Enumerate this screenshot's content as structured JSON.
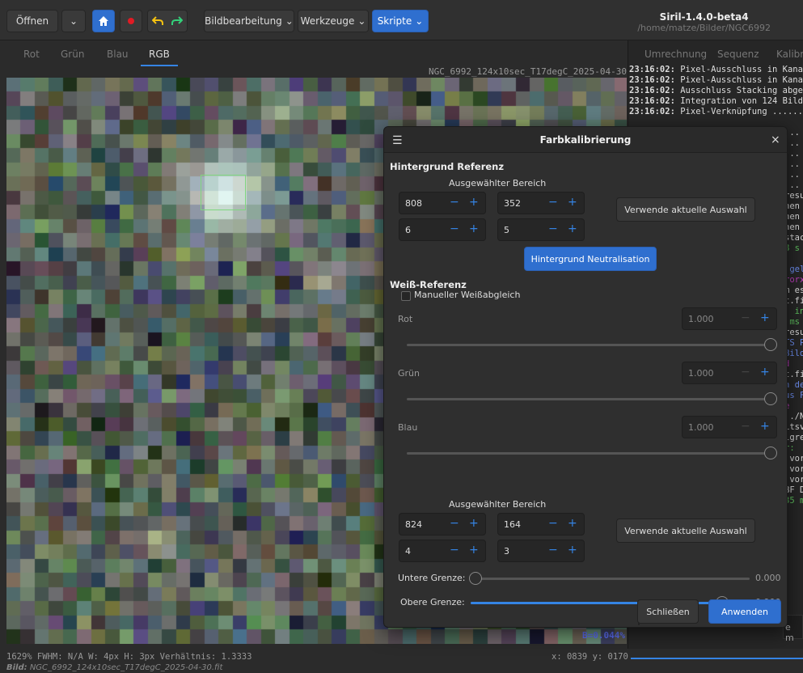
{
  "header": {
    "open_label": "Öffnen",
    "image_processing_label": "Bildbearbeitung",
    "tools_label": "Werkzeuge",
    "scripts_label": "Skripte",
    "app_title": "Siril-1.4.0-beta4",
    "app_path": "/home/matze/Bilder/NGC6992"
  },
  "channel_tabs": [
    "Rot",
    "Grün",
    "Blau",
    "RGB"
  ],
  "active_channel": "RGB",
  "right_tabs": [
    "Umrechnung",
    "Sequenz",
    "Kalibr"
  ],
  "image": {
    "filename": "NGC_6992_124x10sec_T17degC_2025-04-30.fit",
    "b_value": "B=0.044%"
  },
  "console": [
    {
      "time": "23:16:02:",
      "text": " Pixel-Ausschluss in Kanal"
    },
    {
      "time": "23:16:02:",
      "text": " Pixel-Ausschluss in Kanal"
    },
    {
      "time": "23:16:02:",
      "text": " Ausschluss Stacking abgesc"
    },
    {
      "time": "23:16:02:",
      "text": " Integration von 124 Bilder"
    },
    {
      "time": "23:16:02:",
      "text": " Pixel-Verknüpfung ........"
    }
  ],
  "console_tail": [
    {
      "text": "",
      "color": "#ddd"
    },
    {
      "text": "...",
      "color": "#ddd"
    },
    {
      "text": "...",
      "color": "#ddd"
    },
    {
      "text": "...",
      "color": "#ddd"
    },
    {
      "text": "... n",
      "color": "#ddd"
    },
    {
      "text": "...",
      "color": "#ddd"
    },
    {
      "text": "...",
      "color": "#ddd"
    },
    {
      "text": "resu",
      "color": "#ddd"
    },
    {
      "text": "hen",
      "color": "#ddd"
    },
    {
      "text": "hen",
      "color": "#ddd"
    },
    {
      "text": "hen",
      "color": "#ddd"
    },
    {
      "text": "stac",
      "color": "#ddd"
    },
    {
      "text": "8 s",
      "color": "#5ec05e"
    },
    {
      "text": "",
      "color": "#ddd"
    },
    {
      "text": " gel",
      "color": "#6d8ef0"
    },
    {
      "text": "rorx",
      "color": "#c03fc0"
    },
    {
      "text": "m es",
      "color": "#ddd"
    },
    {
      "text": "t.fi",
      "color": "#ddd"
    },
    {
      "text": ": in",
      "color": "#5ec05e"
    },
    {
      "text": " ms",
      "color": "#5ec05e"
    },
    {
      "text": "resu",
      "color": "#ddd"
    },
    {
      "text": "TS P",
      "color": "#6d8ef0"
    },
    {
      "text": "Bild",
      "color": "#6d8ef0"
    },
    {
      "text": "d",
      "color": "#c03fc0"
    },
    {
      "text": "t.fi",
      "color": "#ddd"
    },
    {
      "text": "n de",
      "color": "#6d8ef0"
    },
    {
      "text": "us F",
      "color": "#6d8ef0"
    },
    {
      "text": "e",
      "color": "#c03fc0"
    },
    {
      "text": "../N",
      "color": "#ddd"
    },
    {
      "text": "itsv",
      "color": "#ddd"
    },
    {
      "text": "lgre",
      "color": "#ddd"
    },
    {
      "text": "r: ",
      "color": "#5ec05e"
    },
    {
      "text": " vor",
      "color": "#ddd"
    },
    {
      "text": " vor",
      "color": "#ddd"
    },
    {
      "text": " vor",
      "color": "#ddd"
    },
    {
      "text": "BF D",
      "color": "#ddd"
    },
    {
      "text": "35 m",
      "color": "#5ec05e"
    }
  ],
  "console_input_text": "e m",
  "status": {
    "left": "1629%   FWHM: N/A   W: 4px H: 3px Verhältnis: 1.3333",
    "xy": "x: 0839 y: 0170",
    "file_prefix": "Bild:",
    "file_name": "NGC_6992_124x10sec_T17degC_2025-04-30.fit"
  },
  "dialog": {
    "title": "Farbkalibrierung",
    "bg_ref_title": "Hintergrund Referenz",
    "selected_area_label": "Ausgewählter Bereich",
    "bg": {
      "x": "808",
      "y": "352",
      "w": "6",
      "h": "5"
    },
    "use_selection_label": "Verwende aktuelle Auswahl",
    "bg_neutralize_label": "Hintergrund Neutralisation",
    "white_ref_title": "Weiß-Referenz",
    "manual_wb_label": "Manueller Weißabgleich",
    "channels": [
      {
        "label": "Rot",
        "value": "1.000"
      },
      {
        "label": "Grün",
        "value": "1.000"
      },
      {
        "label": "Blau",
        "value": "1.000"
      }
    ],
    "wb_area_label": "Ausgewählter Bereich",
    "wb": {
      "x": "824",
      "y": "164",
      "w": "4",
      "h": "3"
    },
    "lower_label": "Untere Grenze:",
    "lower_value": "0.000",
    "upper_label": "Obere Grenze:",
    "upper_value": "0.900",
    "upper_fraction": 0.9,
    "close_label": "Schließen",
    "apply_label": "Anwenden"
  },
  "colors": {
    "accent": "#3584e4",
    "button_blue": "#2f6fcf",
    "record_red": "#e01b24",
    "undo_yellow": "#f5c211",
    "redo_green": "#33d17a"
  }
}
